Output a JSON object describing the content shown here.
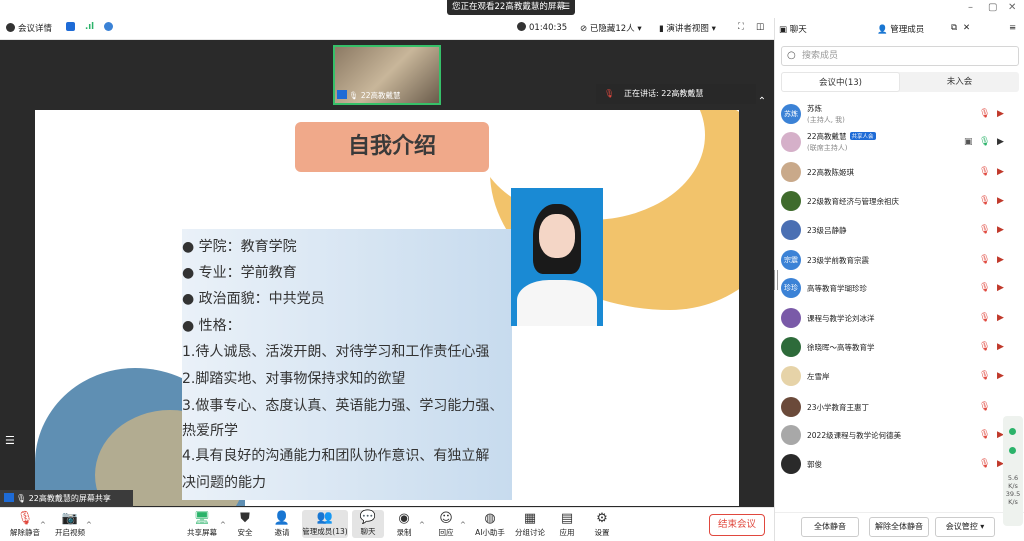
{
  "window": {
    "title": "您正在观看22高教戴慧的屏幕",
    "title_icon": "☰",
    "minimize": "–",
    "maximize": "▢",
    "close": "✕"
  },
  "topbar": {
    "meeting_info": "会议详情",
    "timer": "01:40:35",
    "hidden_count": "已隐藏12人",
    "view_mode": "演讲者视图",
    "colors": {
      "shield": "#1e6bd6",
      "signal": "#2bb36a"
    }
  },
  "stage": {
    "video_thumb_label": "22高教戴慧",
    "speaking_label": "正在讲话:",
    "speaking_name": "22高教戴慧",
    "share_label": "22高教戴慧的屏幕共享"
  },
  "slide": {
    "title": "自我介绍",
    "lines": [
      "● 学院：教育学院",
      "● 专业：学前教育",
      "● 政治面貌：中共党员",
      "● 性格：",
      "1.待人诚恳、活泼开朗、对待学习和工作责任心强",
      "2.脚踏实地、对事物保持求知的欲望",
      "3.做事专心、态度认真、英语能力强、学习能力强、",
      "热爱所学",
      "4.具有良好的沟通能力和团队协作意识、有独立解",
      "决问题的能力"
    ],
    "colors": {
      "title_bg": "#f0a98a",
      "accent_yellow": "#f2c36b",
      "accent_blue": "#5f8fb3"
    }
  },
  "bottombar": {
    "items": [
      {
        "name": "unmute",
        "icon": "mic-off-icon",
        "glyph": "🎙",
        "label": "解除静音"
      },
      {
        "name": "start-video",
        "icon": "camera-off-icon",
        "glyph": "📷",
        "label": "开启视频"
      },
      {
        "name": "share-screen",
        "icon": "share-screen-icon",
        "glyph": "🖥",
        "label": "共享屏幕"
      },
      {
        "name": "security",
        "icon": "shield-icon",
        "glyph": "⛊",
        "label": "安全"
      },
      {
        "name": "invite",
        "icon": "invite-icon",
        "glyph": "👤",
        "label": "邀请"
      },
      {
        "name": "manage-members",
        "icon": "members-icon",
        "glyph": "👥",
        "label": "管理成员(13)"
      },
      {
        "name": "chat",
        "icon": "chat-icon",
        "glyph": "💬",
        "label": "聊天"
      },
      {
        "name": "record",
        "icon": "record-icon",
        "glyph": "◉",
        "label": "录制"
      },
      {
        "name": "reactions",
        "icon": "reaction-icon",
        "glyph": "☺",
        "label": "回应"
      },
      {
        "name": "ai-assistant",
        "icon": "ai-icon",
        "glyph": "◍",
        "label": "AI小助手"
      },
      {
        "name": "breakout",
        "icon": "breakout-icon",
        "glyph": "▦",
        "label": "分组讨论"
      },
      {
        "name": "apps",
        "icon": "apps-icon",
        "glyph": "▤",
        "label": "应用"
      },
      {
        "name": "settings",
        "icon": "gear-icon",
        "glyph": "⚙",
        "label": "设置"
      }
    ],
    "end_meeting": "结束会议",
    "end_color": "#e0483e"
  },
  "panel": {
    "chat_tab": "聊天",
    "members_tab": "管理成员",
    "search_placeholder": "搜索成员",
    "tab_in_meeting": "会议中(13)",
    "tab_not_joined": "未入会",
    "members": [
      {
        "name": "苏炼",
        "sub": "(主持人, 我)",
        "avatar": "苏炼",
        "avatar_color": "#3b82d6"
      },
      {
        "name": "22高教戴慧",
        "badge": "共享人会",
        "sub": "(联席主持人)",
        "avatar": "",
        "avatar_color": "#d5b0c9"
      },
      {
        "name": "22高教陈姬琪",
        "avatar": "",
        "avatar_color": "#c9a98a"
      },
      {
        "name": "22级教育经济与管理余祖庆",
        "avatar": "",
        "avatar_color": "#3f6b2c"
      },
      {
        "name": "23级吕静静",
        "avatar": "",
        "avatar_color": "#4a6fb3"
      },
      {
        "name": "23级学前教育宗震",
        "avatar": "宗震",
        "avatar_color": "#3b82d6"
      },
      {
        "name": "高等教育学瑚珍珍",
        "avatar": "珍珍",
        "avatar_color": "#3b82d6"
      },
      {
        "name": "课程与教学论刘冰洋",
        "avatar": "",
        "avatar_color": "#7a5aa8"
      },
      {
        "name": "徐晓晖～高等教育学",
        "avatar": "",
        "avatar_color": "#2d6b3a"
      },
      {
        "name": "左雪岸",
        "avatar": "",
        "avatar_color": "#e6d3a8"
      },
      {
        "name": "23小学教育王惠丁",
        "avatar": "",
        "avatar_color": "#6b4a3a"
      },
      {
        "name": "2022级课程与教学论何德美",
        "avatar": "",
        "avatar_color": "#a8a8a8"
      },
      {
        "name": "郭俊",
        "avatar": "",
        "avatar_color": "#2a2a2a"
      }
    ],
    "mute_all": "全体静音",
    "unmute_all": "解除全体静音",
    "meeting_control": "会议管控",
    "net_up": "5.6",
    "net_down": "39.5",
    "net_unit": "K/s"
  }
}
